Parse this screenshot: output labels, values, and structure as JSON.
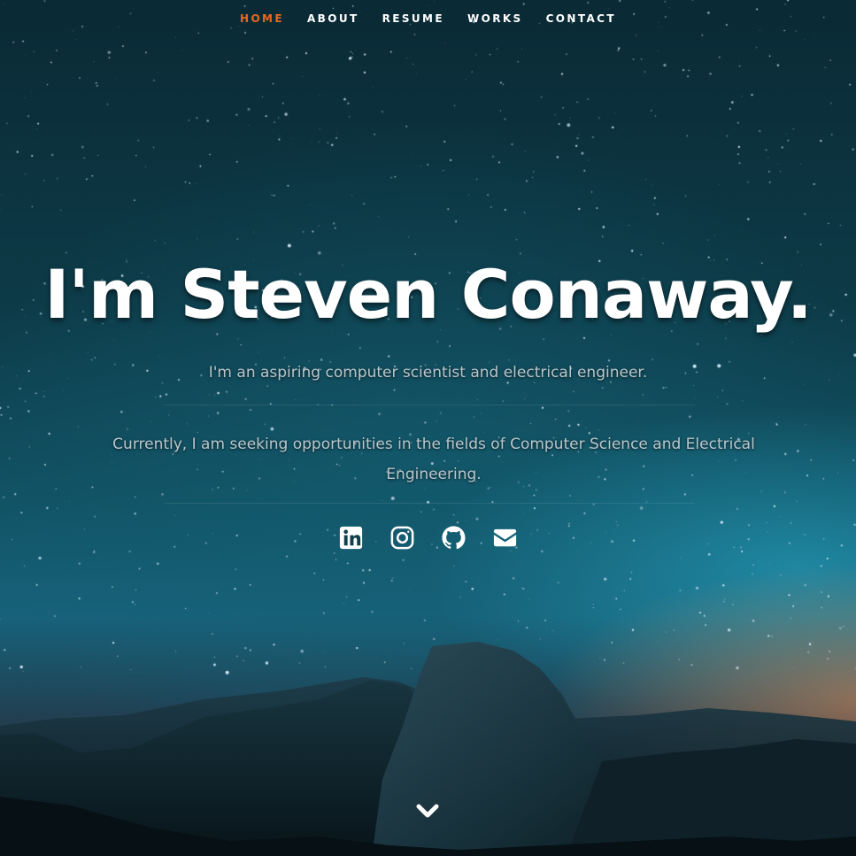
{
  "nav": {
    "items": [
      {
        "label": "HOME",
        "active": true
      },
      {
        "label": "ABOUT",
        "active": false
      },
      {
        "label": "RESUME",
        "active": false
      },
      {
        "label": "WORKS",
        "active": false
      },
      {
        "label": "CONTACT",
        "active": false
      }
    ],
    "active_color": "#e5691f"
  },
  "hero": {
    "title": "I'm Steven Conaway.",
    "tagline": "I'm an aspiring computer scientist and electrical engineer.",
    "seeking": "Currently, I am seeking opportunities in the fields of Computer Science and Electrical Engineering."
  },
  "social": {
    "icons": [
      "linkedin-icon",
      "instagram-icon",
      "github-icon",
      "envelope-icon"
    ]
  },
  "scroll": {
    "icon": "chevron-down-icon"
  }
}
